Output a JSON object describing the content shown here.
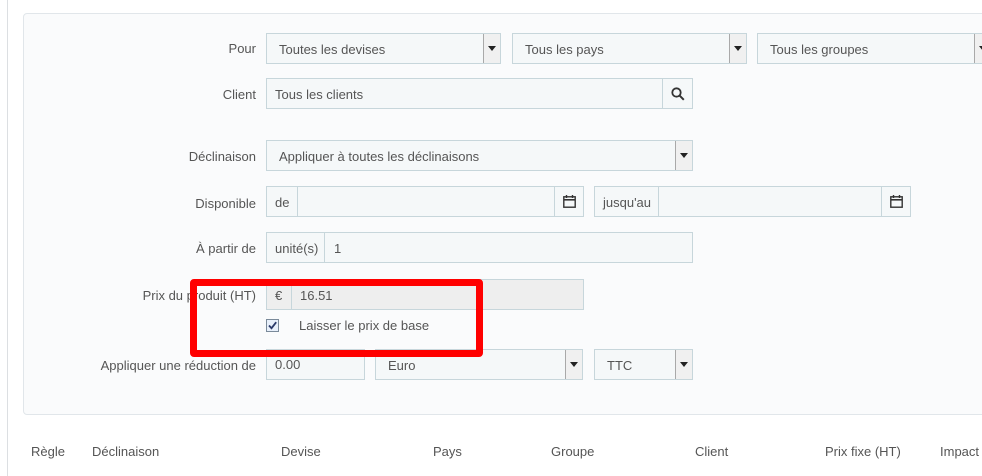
{
  "form": {
    "pour": {
      "label": "Pour",
      "devise": "Toutes les devises",
      "pays": "Tous les pays",
      "groupe": "Tous les groupes"
    },
    "client": {
      "label": "Client",
      "value": "Tous les clients"
    },
    "declinaison": {
      "label": "Déclinaison",
      "value": "Appliquer à toutes les déclinaisons"
    },
    "disponible": {
      "label": "Disponible",
      "from_prefix": "de",
      "from_value": "",
      "to_prefix": "jusqu'au",
      "to_value": ""
    },
    "a_partir_de": {
      "label": "À partir de",
      "unit": "unité(s)",
      "value": "1"
    },
    "prix": {
      "label": "Prix du produit (HT)",
      "currency": "€",
      "value": "16.51",
      "keep_base_label": "Laisser le prix de base",
      "keep_base_checked": true
    },
    "reduction": {
      "label": "Appliquer une réduction de",
      "value": "0.00",
      "type": "Euro",
      "tax": "TTC"
    }
  },
  "table": {
    "headers": [
      "Règle",
      "Déclinaison",
      "Devise",
      "Pays",
      "Groupe",
      "Client",
      "Prix fixe (HT)",
      "Impact"
    ]
  },
  "colors": {
    "highlight": "#ff0000",
    "field_bg": "#f5f8f9",
    "field_border": "#c7d6db"
  }
}
